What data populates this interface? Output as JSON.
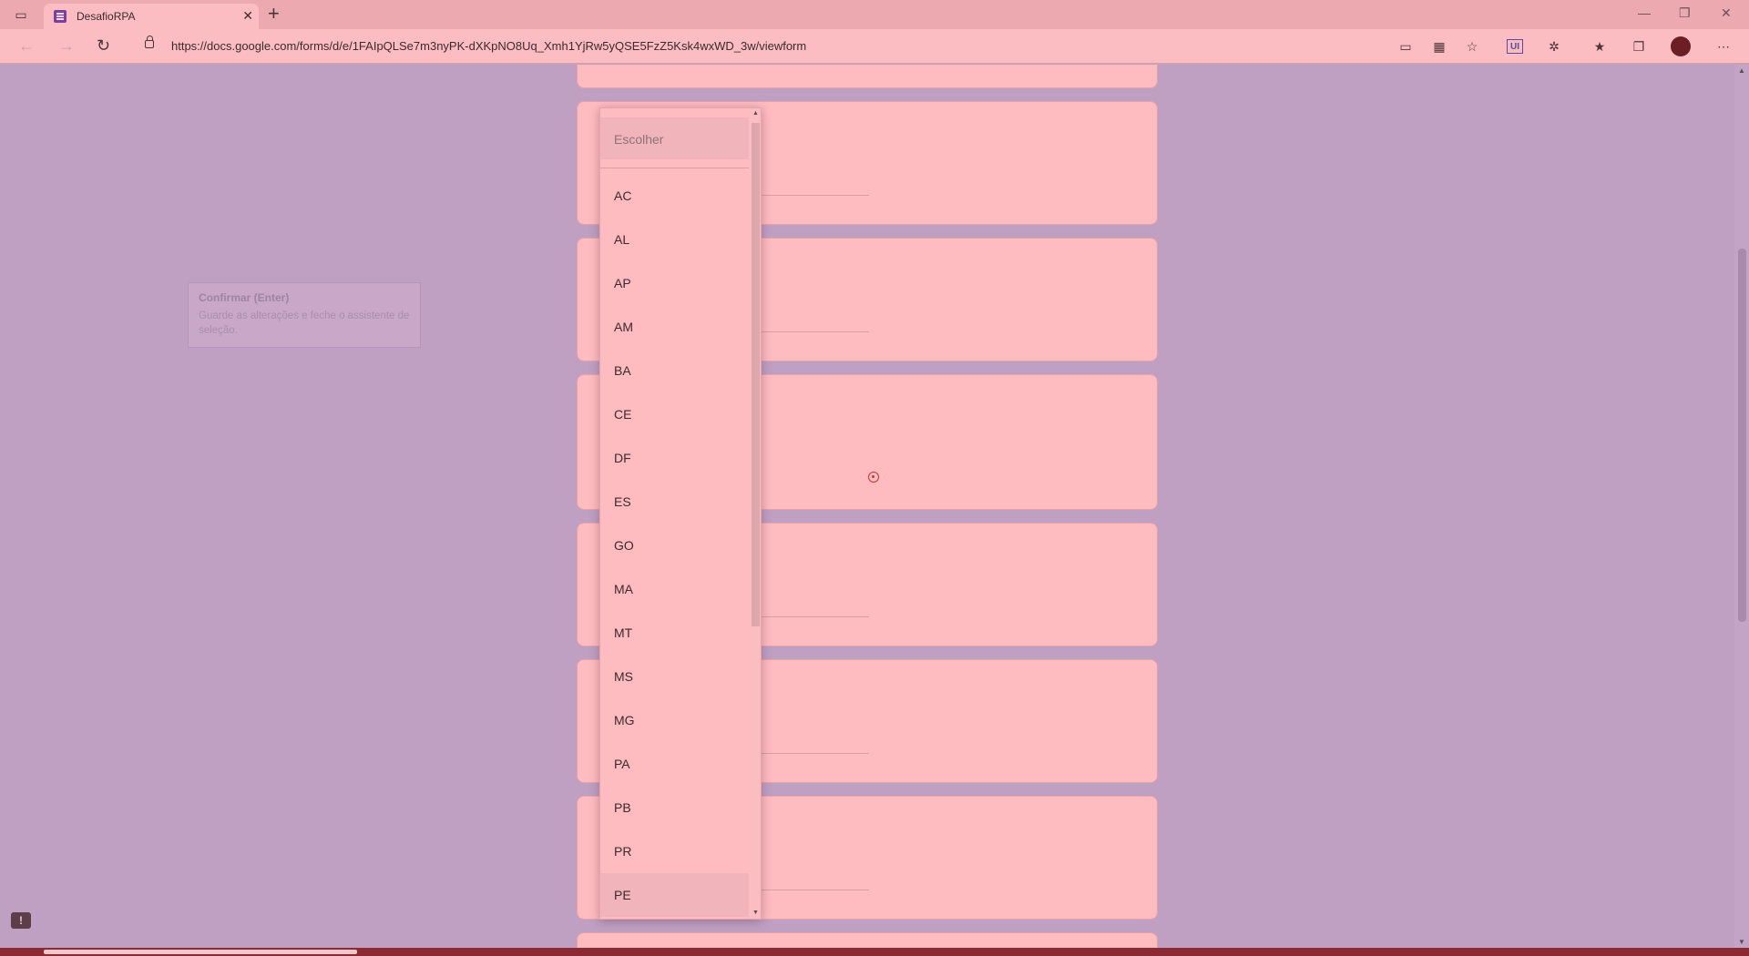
{
  "browser": {
    "tab_title": "DesafioRPA",
    "tab_close": "✕",
    "new_tab": "+",
    "url": "https://docs.google.com/forms/d/e/1FAIpQLSe7m3nyPK-dXKpNO8Uq_Xmh1YjRw5yQSE5FzZ5Ksk4wxWD_3w/viewform",
    "toolbar_badge": "UI",
    "icons": {
      "sidebar": "▭",
      "back": "←",
      "forward": "→",
      "refresh": "↻",
      "minimize": "—",
      "restore": "❐",
      "close": "✕",
      "more": "⋯"
    }
  },
  "tooltip": {
    "title": "Confirmar (Enter)",
    "body": "Guarde as alterações e feche o assistente de seleção."
  },
  "dropdown": {
    "placeholder": "Escolher",
    "options": [
      "AC",
      "AL",
      "AP",
      "AM",
      "BA",
      "CE",
      "DF",
      "ES",
      "GO",
      "MA",
      "MT",
      "MS",
      "MG",
      "PA",
      "PB",
      "PR",
      "PE"
    ],
    "hovered": "PE"
  },
  "feedback_icon": "!"
}
